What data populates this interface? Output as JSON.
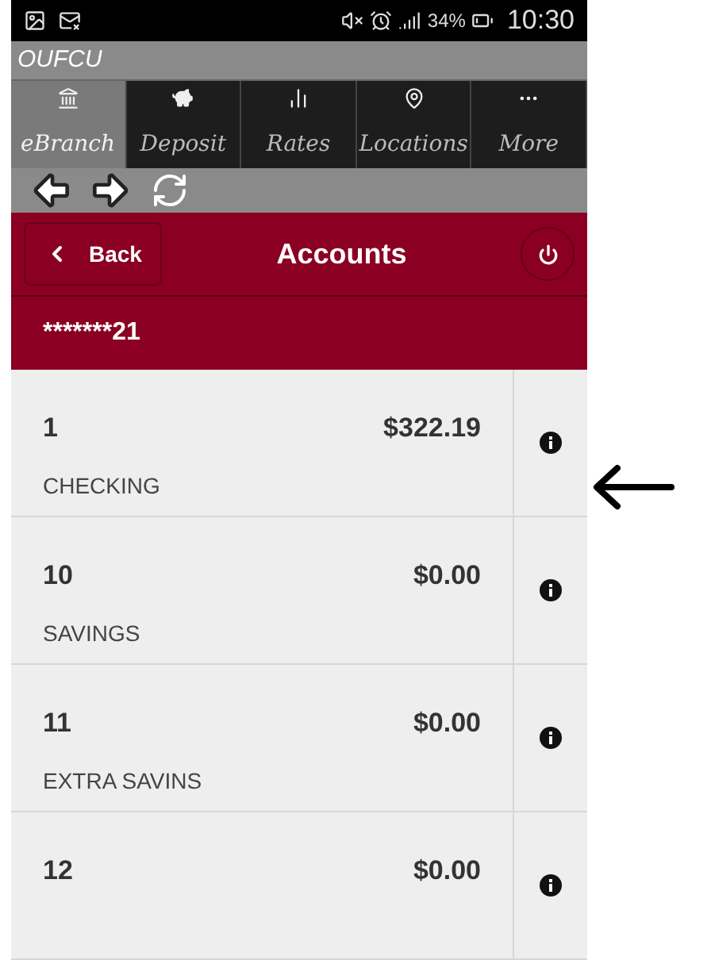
{
  "status_bar": {
    "battery": "34%",
    "time": "10:30"
  },
  "app_title": "OUFCU",
  "tabs": [
    {
      "label": "eBranch",
      "kind": "bank",
      "selected": true
    },
    {
      "label": "Deposit",
      "kind": "piggy",
      "selected": false
    },
    {
      "label": "Rates",
      "kind": "chart",
      "selected": false
    },
    {
      "label": "Locations",
      "kind": "pin",
      "selected": false
    },
    {
      "label": "More",
      "kind": "dots",
      "selected": false
    }
  ],
  "header": {
    "back": "Back",
    "title": "Accounts"
  },
  "member": "*******21",
  "accounts": [
    {
      "number": "1",
      "balance": "$322.19",
      "type": "CHECKING"
    },
    {
      "number": "10",
      "balance": "$0.00",
      "type": "SAVINGS"
    },
    {
      "number": "11",
      "balance": "$0.00",
      "type": "EXTRA SAVINS"
    },
    {
      "number": "12",
      "balance": "$0.00"
    }
  ]
}
